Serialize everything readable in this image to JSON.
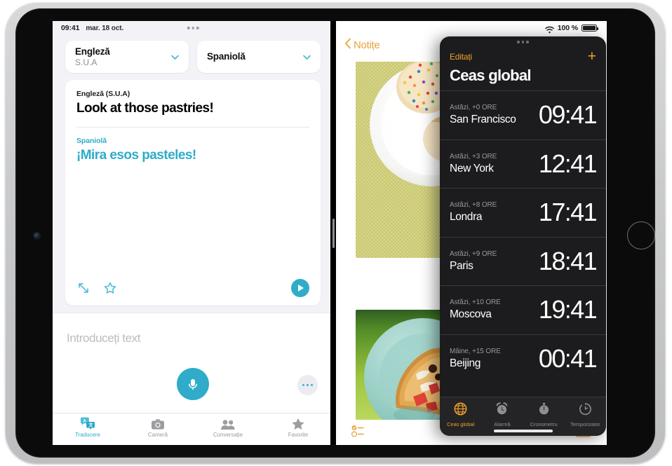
{
  "device": {
    "name": "iPad"
  },
  "translate": {
    "status": {
      "time": "09:41",
      "date": "mar. 18 oct."
    },
    "source_language": {
      "name": "Engleză",
      "region": "S.U.A"
    },
    "target_language": {
      "name": "Spaniolă",
      "region": ""
    },
    "card": {
      "source_label": "Engleză (S.U.A)",
      "source_text": "Look at those pastries!",
      "target_label": "Spaniolă",
      "target_text": "¡Mira esos pasteles!",
      "expand_icon": "expand-arrows-icon",
      "favorite_icon": "star-outline-icon",
      "play_icon": "play-circle-icon"
    },
    "input": {
      "placeholder": "Introduceți text",
      "mic_icon": "microphone-icon",
      "more_icon": "ellipsis-icon"
    },
    "tabs": [
      {
        "label": "Traducere",
        "icon": "translate-icon",
        "active": true
      },
      {
        "label": "Cameră",
        "icon": "camera-icon",
        "active": false
      },
      {
        "label": "Conversație",
        "icon": "people-icon",
        "active": false
      },
      {
        "label": "Favorite",
        "icon": "star-filled-icon",
        "active": false
      }
    ],
    "accent_color": "#2eacc9"
  },
  "notes": {
    "status": {
      "wifi_icon": "wifi-icon",
      "battery_text": "100 %",
      "battery_icon": "battery-full-icon"
    },
    "back_label": "Notițe",
    "back_icon": "chevron-left-icon",
    "photos": [
      {
        "alt": "sprinkle-cookie-on-white-plate"
      },
      {
        "alt": "pastry-with-cream-and-strawberries-on-teal-plate"
      }
    ],
    "toolbar": {
      "checklist_icon": "checklist-icon",
      "camera_icon": "camera-icon"
    },
    "accent_color": "#e8a33d"
  },
  "clock": {
    "grabber_icon": "grabber-dots-icon",
    "edit_label": "Editați",
    "add_icon": "plus-icon",
    "title": "Ceas global",
    "entries": [
      {
        "offset": "Astăzi, +0 ORE",
        "city": "San Francisco",
        "time": "09:41"
      },
      {
        "offset": "Astăzi, +3 ORE",
        "city": "New York",
        "time": "12:41"
      },
      {
        "offset": "Astăzi, +8 ORE",
        "city": "Londra",
        "time": "17:41"
      },
      {
        "offset": "Astăzi, +9 ORE",
        "city": "Paris",
        "time": "18:41"
      },
      {
        "offset": "Astăzi, +10 ORE",
        "city": "Moscova",
        "time": "19:41"
      },
      {
        "offset": "Mâine, +15 ORE",
        "city": "Beijing",
        "time": "00:41"
      }
    ],
    "tabs": [
      {
        "label": "Ceas global",
        "icon": "globe-icon",
        "active": true
      },
      {
        "label": "Alarmă",
        "icon": "alarm-clock-icon",
        "active": false
      },
      {
        "label": "Cronometru",
        "icon": "stopwatch-icon",
        "active": false
      },
      {
        "label": "Temporizator",
        "icon": "timer-icon",
        "active": false
      }
    ],
    "accent_color": "#f0a02a",
    "background_color": "#1c1c1e"
  }
}
